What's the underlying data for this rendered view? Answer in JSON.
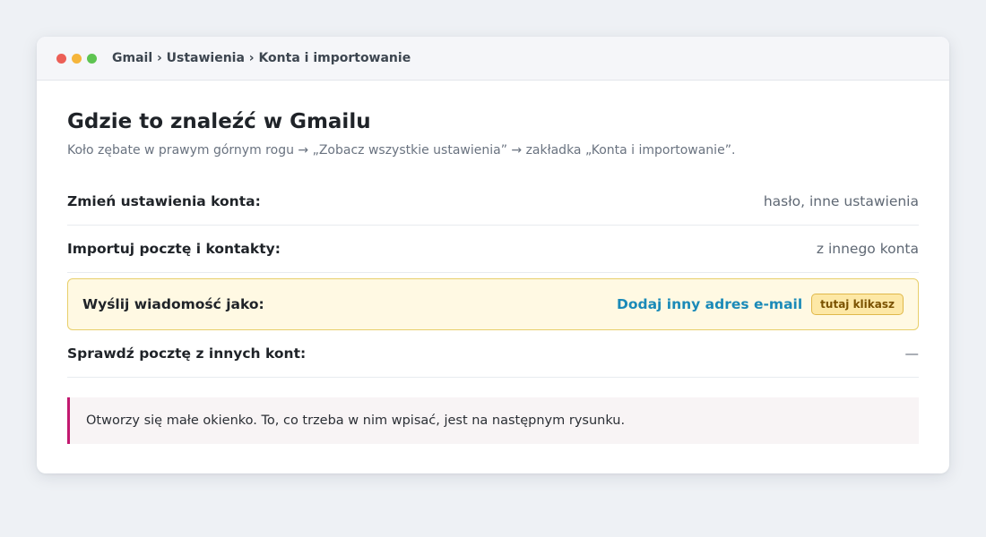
{
  "window": {
    "breadcrumb": "Gmail › Ustawienia › Konta i importowanie"
  },
  "main": {
    "title": "Gdzie to znaleźć w Gmailu",
    "subtitle": "Koło zębate w prawym górnym rogu → „Zobacz wszystkie ustawienia” → zakładka „Konta i importowanie”.",
    "rows": [
      {
        "label": "Zmień ustawienia konta:",
        "value": "hasło, inne ustawienia"
      },
      {
        "label": "Importuj pocztę i kontakty:",
        "value": "z innego konta"
      },
      {
        "label": "Wyślij wiadomość jako:",
        "link": "Dodaj inny adres e-mail",
        "badge": "tutaj klikasz"
      },
      {
        "label": "Sprawdź pocztę z innych kont:",
        "value": "—"
      }
    ],
    "note": "Otworzy się małe okienko. To, co trzeba w nim wpisać, jest na następnym rysunku."
  },
  "colors": {
    "link": "#1a8ab8",
    "highlight_bg": "#fff9e3",
    "highlight_border": "#e8cf6a",
    "note_accent": "#c2186f"
  }
}
